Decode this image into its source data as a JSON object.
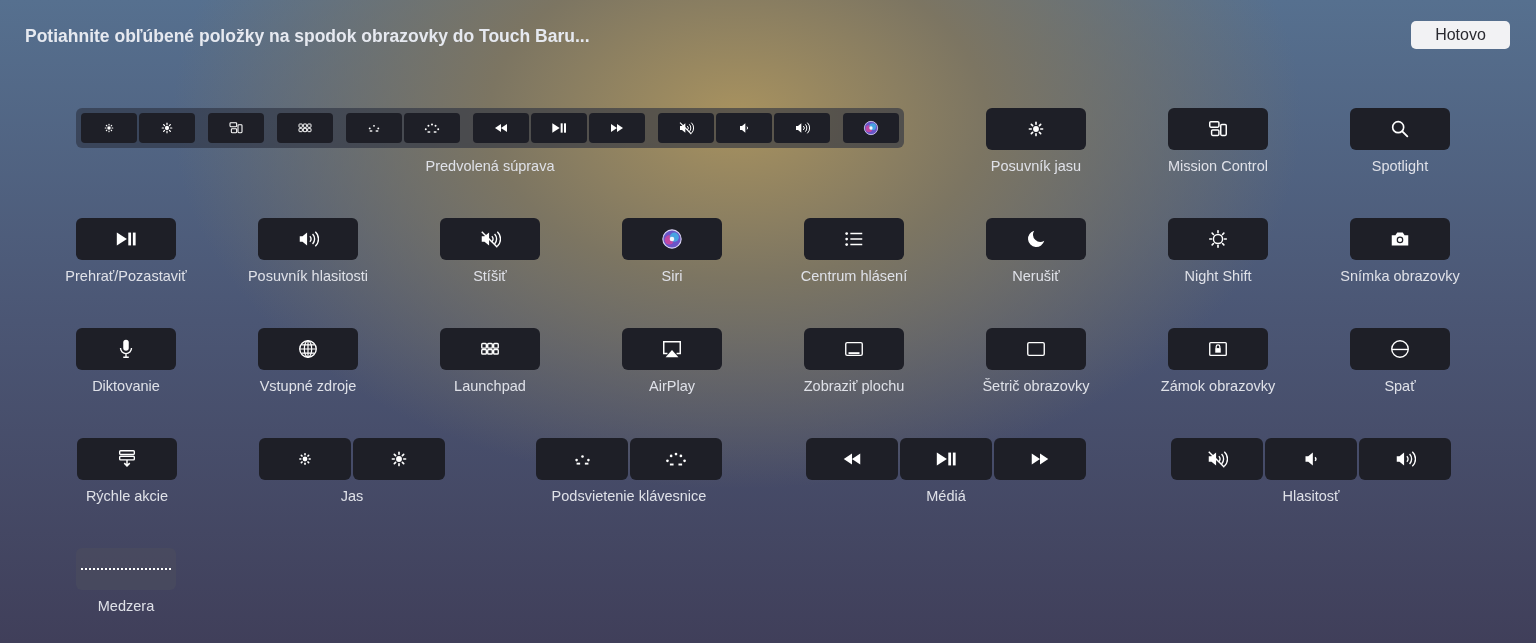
{
  "title": "Potiahnite obľúbené položky na spodok obrazovky do Touch Baru...",
  "done_button": "Hotovo",
  "default_set": {
    "label": "Predvolená súprava",
    "groups": [
      {
        "keys": [
          {
            "kind": "brightness-down"
          },
          {
            "kind": "brightness-up"
          }
        ]
      },
      {
        "keys": [
          {
            "kind": "mission-control"
          }
        ]
      },
      {
        "keys": [
          {
            "kind": "launchpad"
          }
        ]
      },
      {
        "keys": [
          {
            "kind": "keyboard-down"
          },
          {
            "kind": "keyboard-up"
          }
        ]
      },
      {
        "keys": [
          {
            "kind": "rewind"
          },
          {
            "kind": "play-pause"
          },
          {
            "kind": "fast-forward"
          }
        ]
      },
      {
        "keys": [
          {
            "kind": "mute"
          },
          {
            "kind": "volume-down"
          },
          {
            "kind": "volume-up"
          }
        ]
      },
      {
        "keys": [
          {
            "kind": "siri"
          }
        ]
      }
    ]
  },
  "rows": [
    {
      "items": [
        {
          "label": "Posuvník jasu",
          "keys": [
            {
              "kind": "brightness-up"
            }
          ]
        },
        {
          "label": "Mission Control",
          "keys": [
            {
              "kind": "mission-control"
            }
          ]
        },
        {
          "label": "Spotlight",
          "keys": [
            {
              "kind": "search"
            }
          ]
        }
      ]
    },
    {
      "items": [
        {
          "label": "Prehrať/Pozastaviť",
          "keys": [
            {
              "kind": "play-pause"
            }
          ]
        },
        {
          "label": "Posuvník hlasitosti",
          "keys": [
            {
              "kind": "volume-up"
            }
          ]
        },
        {
          "label": "Stíšiť",
          "keys": [
            {
              "kind": "mute"
            }
          ]
        },
        {
          "label": "Siri",
          "keys": [
            {
              "kind": "siri"
            }
          ]
        },
        {
          "label": "Centrum hlásení",
          "keys": [
            {
              "kind": "list"
            }
          ]
        },
        {
          "label": "Nerušiť",
          "keys": [
            {
              "kind": "moon"
            }
          ]
        },
        {
          "label": "Night Shift",
          "keys": [
            {
              "kind": "night-shift"
            }
          ]
        },
        {
          "label": "Snímka obrazovky",
          "keys": [
            {
              "kind": "camera"
            }
          ]
        }
      ]
    },
    {
      "items": [
        {
          "label": "Diktovanie",
          "keys": [
            {
              "kind": "microphone"
            }
          ]
        },
        {
          "label": "Vstupné zdroje",
          "keys": [
            {
              "kind": "globe"
            }
          ]
        },
        {
          "label": "Launchpad",
          "keys": [
            {
              "kind": "launchpad"
            }
          ]
        },
        {
          "label": "AirPlay",
          "keys": [
            {
              "kind": "airplay"
            }
          ]
        },
        {
          "label": "Zobraziť plochu",
          "keys": [
            {
              "kind": "desktop"
            }
          ]
        },
        {
          "label": "Šetrič obrazovky",
          "keys": [
            {
              "kind": "screensaver"
            }
          ]
        },
        {
          "label": "Zámok obrazovky",
          "keys": [
            {
              "kind": "lock"
            }
          ]
        },
        {
          "label": "Spať",
          "keys": [
            {
              "kind": "sleep"
            }
          ]
        }
      ]
    },
    {
      "items": [
        {
          "label": "Rýchle akcie",
          "keys": [
            {
              "kind": "quick-actions"
            }
          ]
        },
        {
          "label": "Jas",
          "keys": [
            {
              "kind": "brightness-down"
            },
            {
              "kind": "brightness-up"
            }
          ]
        },
        {
          "label": "Podsvietenie klávesnice",
          "keys": [
            {
              "kind": "keyboard-down"
            },
            {
              "kind": "keyboard-up"
            }
          ]
        },
        {
          "label": "Médiá",
          "keys": [
            {
              "kind": "rewind"
            },
            {
              "kind": "play-pause"
            },
            {
              "kind": "fast-forward"
            }
          ]
        },
        {
          "label": "Hlasitosť",
          "keys": [
            {
              "kind": "mute"
            },
            {
              "kind": "volume-down"
            },
            {
              "kind": "volume-up"
            }
          ]
        }
      ]
    },
    {
      "items": [
        {
          "label": "Medzera",
          "keys": [
            {
              "kind": "space"
            }
          ]
        }
      ]
    }
  ]
}
